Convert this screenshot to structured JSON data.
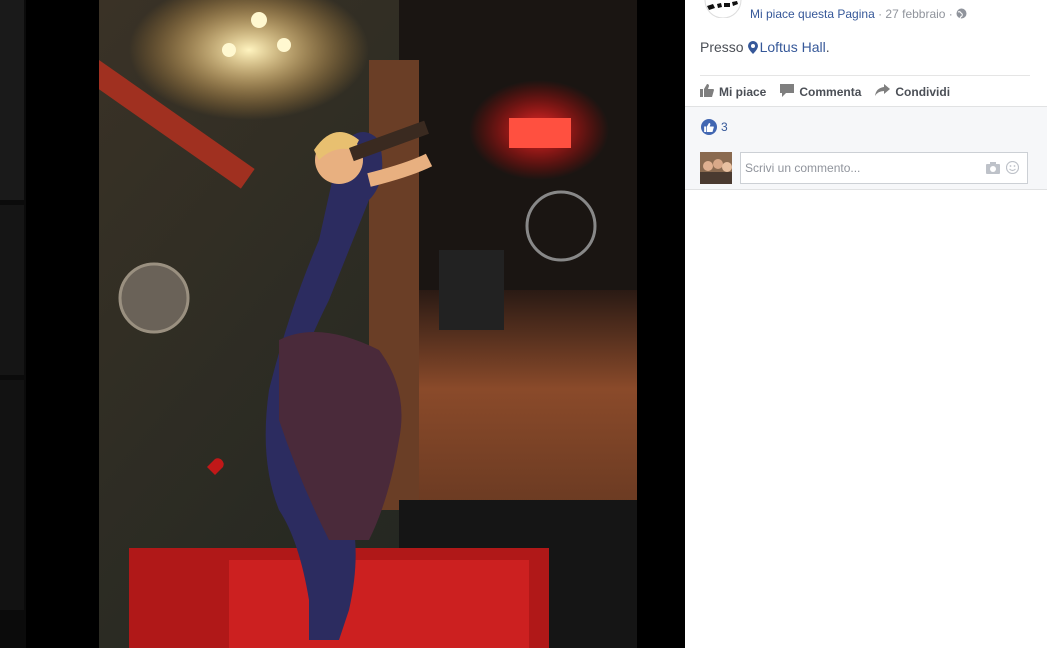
{
  "post": {
    "like_page": "Mi piace questa Pagina",
    "separator1": " · ",
    "date": "27 febbraio",
    "separator2": " · ",
    "location_prefix": "Presso",
    "location_name": "Loftus Hall",
    "location_suffix": "."
  },
  "actions": {
    "like": "Mi piace",
    "comment": "Commenta",
    "share": "Condividi"
  },
  "reactions": {
    "count": "3"
  },
  "comment_box": {
    "placeholder": "Scrivi un commento..."
  },
  "colors": {
    "link": "#365899",
    "text": "#4b4f56",
    "muted": "#90949c",
    "like_blue": "#4267b2"
  },
  "icons": [
    "globe-icon",
    "location-pin-icon",
    "thumbs-up-icon",
    "comment-bubble-icon",
    "share-arrow-icon",
    "camera-icon",
    "emoji-icon"
  ]
}
